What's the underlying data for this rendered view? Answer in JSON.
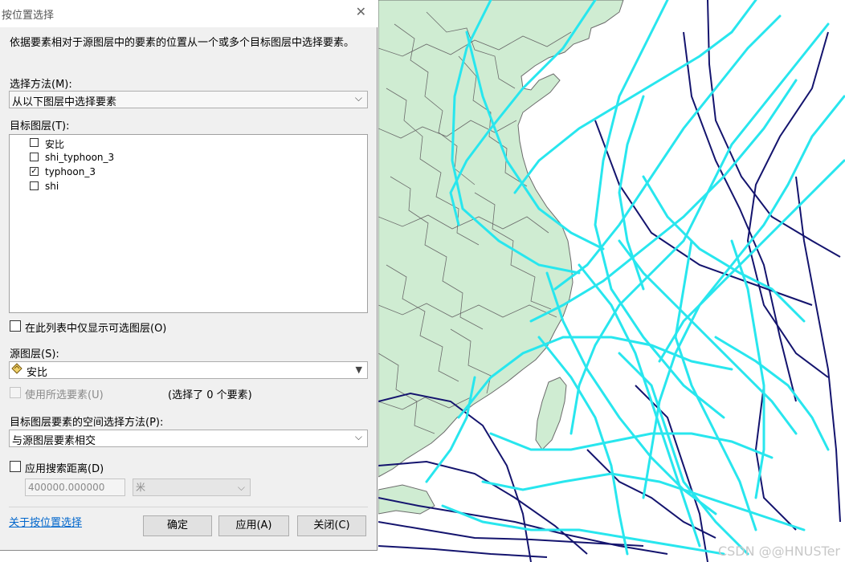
{
  "dialog": {
    "title": "按位置选择",
    "description": "依据要素相对于源图层中的要素的位置从一个或多个目标图层中选择要素。",
    "method_label": "选择方法(M):",
    "method_value": "从以下图层中选择要素",
    "target_label": "目标图层(T):",
    "target_layers": [
      {
        "name": "安比",
        "checked": false
      },
      {
        "name": "shi_typhoon_3",
        "checked": false
      },
      {
        "name": "typhoon_3",
        "checked": true
      },
      {
        "name": "shi",
        "checked": false
      }
    ],
    "only_selectable_label": "在此列表中仅显示可选图层(O)",
    "source_label": "源图层(S):",
    "source_value": "安比",
    "use_selected_label": "使用所选要素(U)",
    "selected_count_text": "(选择了 0 个要素)",
    "spatial_method_label": "目标图层要素的空间选择方法(P):",
    "spatial_method_value": "与源图层要素相交",
    "search_distance_label": "应用搜索距离(D)",
    "distance_value": "400000.000000",
    "unit_value": "米",
    "help_link": "关于按位置选择",
    "buttons": {
      "ok": "确定",
      "apply": "应用(A)",
      "close": "关闭(C)"
    }
  },
  "map": {
    "land_color": "#cfecd2",
    "boundary_color": "#6b6b6b",
    "track_color_cyan": "#28e6ee",
    "track_color_navy": "#14146e"
  },
  "watermark": "CSDN @@HNUSTer"
}
